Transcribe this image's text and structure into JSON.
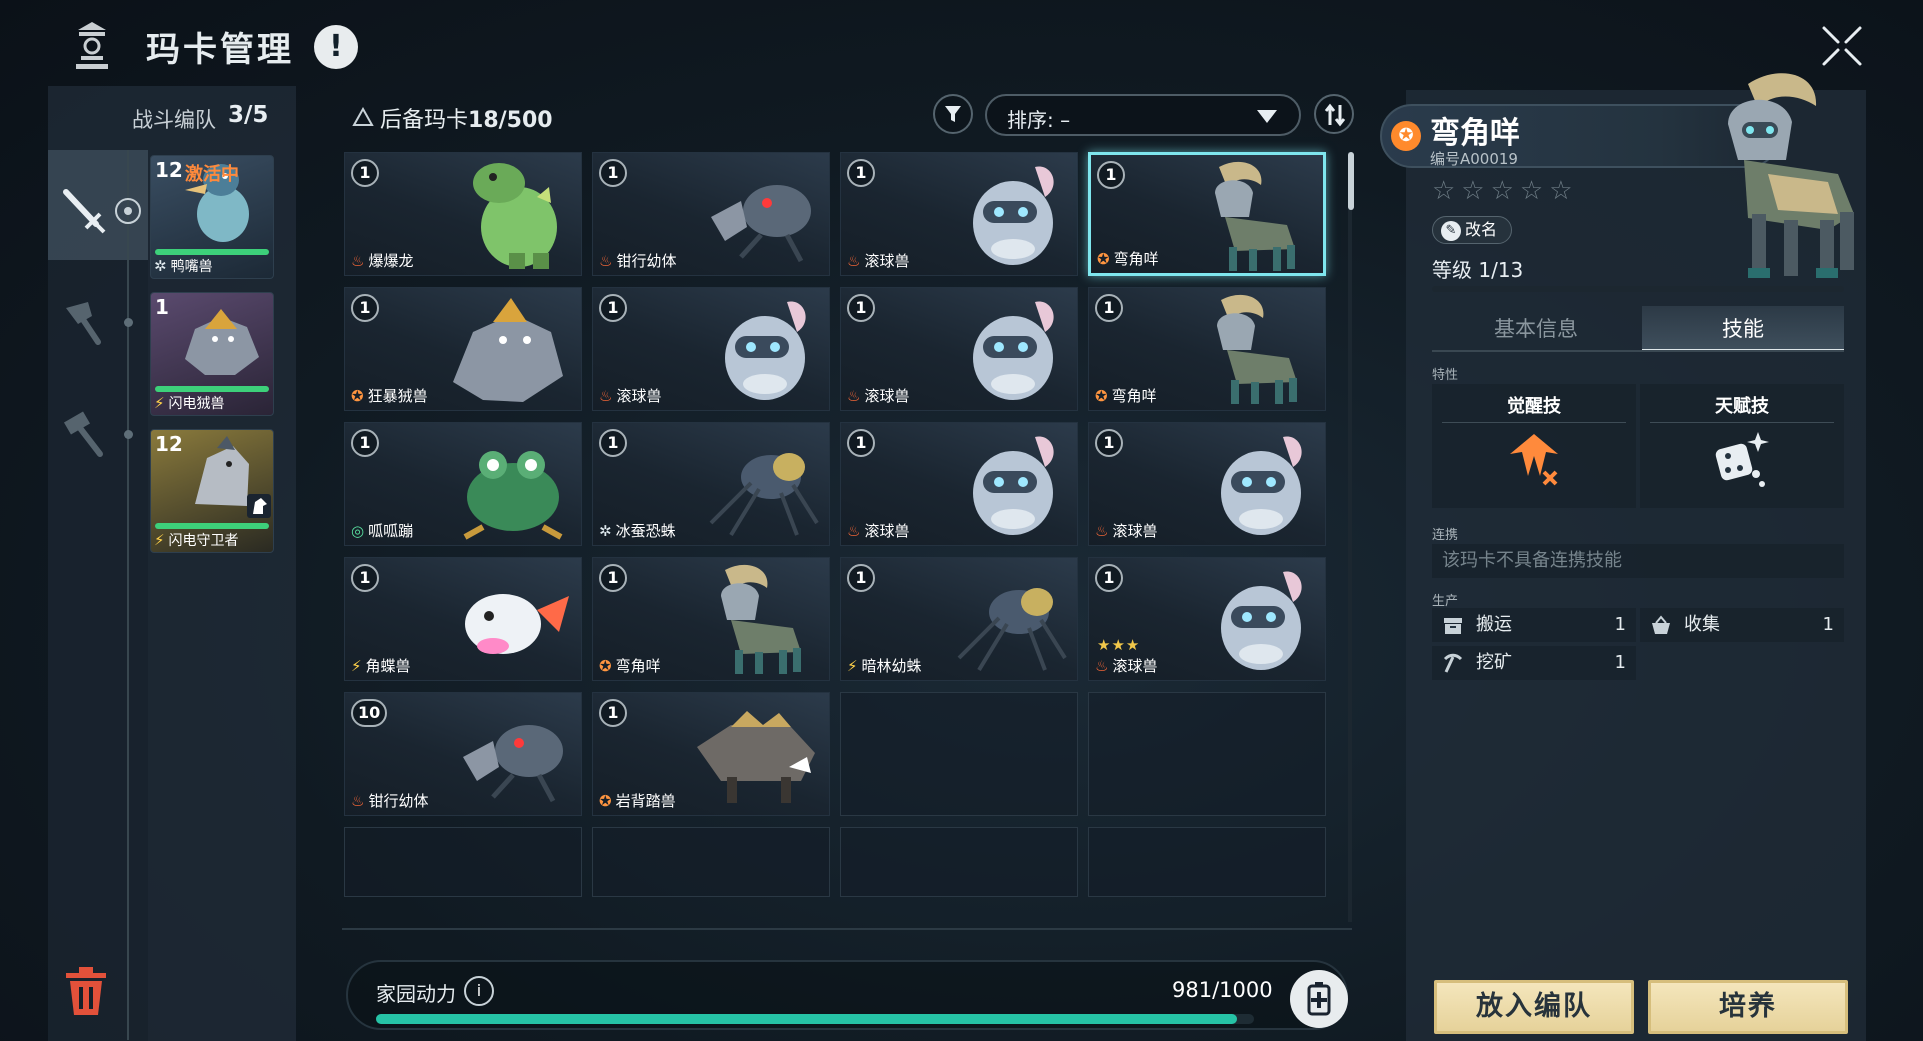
{
  "header": {
    "title": "玛卡管理",
    "help_glyph": "!"
  },
  "team": {
    "label": "战斗编队",
    "count": "3/5",
    "members": [
      {
        "level": "12",
        "status": "激活中",
        "name": "鸭嘴兽",
        "element": "ice",
        "hp_fraction": 1.0
      },
      {
        "level": "1",
        "status": "",
        "name": "闪电狨兽",
        "element": "bolt",
        "hp_fraction": 1.0
      },
      {
        "level": "12",
        "status": "",
        "name": "闪电守卫者",
        "element": "bolt",
        "hp_fraction": 1.0
      }
    ]
  },
  "reserve": {
    "title": "后备玛卡",
    "count": "18/500",
    "sort_label": "排序: –",
    "cards": [
      {
        "level": "1",
        "name": "爆爆龙",
        "element": "fire",
        "art": "dino",
        "selected": false,
        "stars": ""
      },
      {
        "level": "1",
        "name": "钳行幼体",
        "element": "fire",
        "art": "crab",
        "selected": false,
        "stars": ""
      },
      {
        "level": "1",
        "name": "滚球兽",
        "element": "fire",
        "art": "ball",
        "selected": false,
        "stars": ""
      },
      {
        "level": "1",
        "name": "弯角咩",
        "element": "neutral",
        "art": "goat",
        "selected": true,
        "stars": ""
      },
      {
        "level": "1",
        "name": "狂暴狨兽",
        "element": "neutral",
        "art": "beast",
        "selected": false,
        "stars": ""
      },
      {
        "level": "1",
        "name": "滚球兽",
        "element": "fire",
        "art": "ball",
        "selected": false,
        "stars": ""
      },
      {
        "level": "1",
        "name": "滚球兽",
        "element": "fire",
        "art": "ball",
        "selected": false,
        "stars": ""
      },
      {
        "level": "1",
        "name": "弯角咩",
        "element": "neutral",
        "art": "goat",
        "selected": false,
        "stars": ""
      },
      {
        "level": "1",
        "name": "呱呱蹦",
        "element": "wind",
        "art": "frog",
        "selected": false,
        "stars": ""
      },
      {
        "level": "1",
        "name": "冰蚕恐蛛",
        "element": "ice",
        "art": "spider",
        "selected": false,
        "stars": ""
      },
      {
        "level": "1",
        "name": "滚球兽",
        "element": "fire",
        "art": "ball",
        "selected": false,
        "stars": ""
      },
      {
        "level": "1",
        "name": "滚球兽",
        "element": "fire",
        "art": "ball",
        "selected": false,
        "stars": ""
      },
      {
        "level": "1",
        "name": "角蝶兽",
        "element": "bolt",
        "art": "axolotl",
        "selected": false,
        "stars": ""
      },
      {
        "level": "1",
        "name": "弯角咩",
        "element": "neutral",
        "art": "goat",
        "selected": false,
        "stars": ""
      },
      {
        "level": "1",
        "name": "暗林幼蛛",
        "element": "bolt",
        "art": "spider",
        "selected": false,
        "stars": ""
      },
      {
        "level": "1",
        "name": "滚球兽",
        "element": "fire",
        "art": "ball",
        "selected": false,
        "stars": "★★★"
      },
      {
        "level": "10",
        "name": "钳行幼体",
        "element": "fire",
        "art": "crab",
        "selected": false,
        "stars": ""
      },
      {
        "level": "1",
        "name": "岩背踏兽",
        "element": "neutral",
        "art": "boar",
        "selected": false,
        "stars": ""
      }
    ],
    "empty_slots": 6
  },
  "power": {
    "label": "家园动力",
    "value": "981/1000",
    "fraction": 0.981
  },
  "detail": {
    "name": "弯角咩",
    "id": "编号A00019",
    "stars": "☆☆☆☆☆",
    "rename": "改名",
    "level": "等级 1/13",
    "xp_fraction": 0.0,
    "tabs": {
      "basic": "基本信息",
      "skill": "技能"
    },
    "trait_label": "特性",
    "awaken_title": "觉醒技",
    "talent_title": "天赋技",
    "link_label": "连携",
    "link_text": "该玛卡不具备连携技能",
    "production_label": "生产",
    "production": [
      {
        "name": "搬运",
        "value": "1"
      },
      {
        "name": "收集",
        "value": "1"
      },
      {
        "name": "挖矿",
        "value": "1"
      }
    ],
    "buttons": {
      "add_team": "放入编队",
      "train": "培养"
    }
  },
  "colors": {
    "fire": "#ff6a38",
    "bolt": "#ffd24a",
    "ice": "#dfe9ee",
    "neutral": "#ff9540",
    "wind": "#5ae0a0",
    "accent": "#7fe6ee",
    "power": "#26c3a6"
  }
}
